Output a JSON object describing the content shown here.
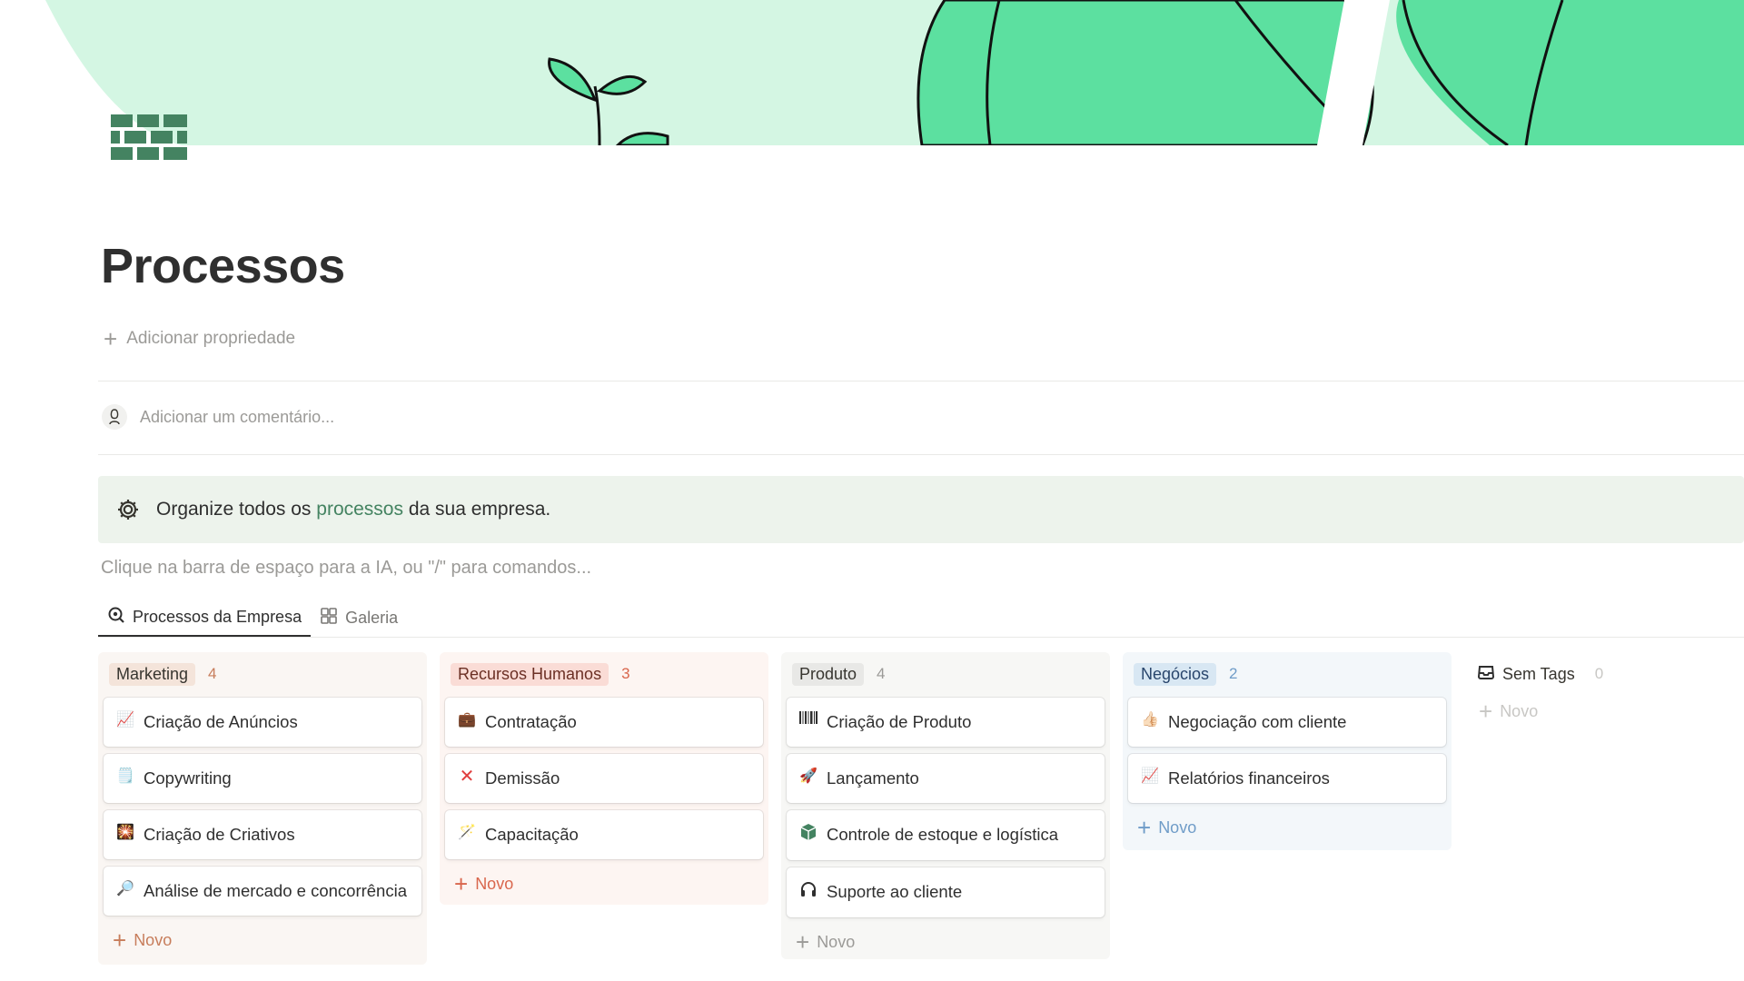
{
  "page": {
    "title": "Processos",
    "add_property": "Adicionar propriedade",
    "comment_placeholder": "Adicionar um comentário...",
    "callout": {
      "prefix": "Organize todos os",
      "highlight": "processos",
      "suffix": "da sua empresa."
    },
    "block_placeholder": "Clique na barra de espaço para a IA, ou \"/\" para comandos..."
  },
  "tabs": [
    {
      "label": "Processos da Empresa",
      "icon": "search-cog-icon",
      "active": true
    },
    {
      "label": "Galeria",
      "icon": "gallery-grid-icon",
      "active": false
    }
  ],
  "board": {
    "new_label": "Novo",
    "columns": [
      {
        "name": "Marketing",
        "count": "4",
        "cards": [
          {
            "icon": "chart-up-icon",
            "label": "Criação de Anúncios"
          },
          {
            "icon": "notepad-icon",
            "label": "Copywriting"
          },
          {
            "icon": "sparkle-image-icon",
            "label": "Criação de Criativos"
          },
          {
            "icon": "magnifier-icon",
            "label": "Análise de mercado e concorrência"
          }
        ]
      },
      {
        "name": "Recursos Humanos",
        "count": "3",
        "cards": [
          {
            "icon": "briefcase-icon",
            "label": "Contratação"
          },
          {
            "icon": "cross-mark-icon",
            "label": "Demissão"
          },
          {
            "icon": "magic-wand-icon",
            "label": "Capacitação"
          }
        ]
      },
      {
        "name": "Produto",
        "count": "4",
        "cards": [
          {
            "icon": "barcode-icon",
            "label": "Criação de Produto"
          },
          {
            "icon": "rocket-icon",
            "label": "Lançamento"
          },
          {
            "icon": "package-icon",
            "label": "Controle de estoque e logística"
          },
          {
            "icon": "headphones-icon",
            "label": "Suporte ao cliente"
          }
        ]
      },
      {
        "name": "Negócios",
        "count": "2",
        "cards": [
          {
            "icon": "thumbs-up-icon",
            "label": "Negociação com cliente"
          },
          {
            "icon": "chart-up-icon",
            "label": "Relatórios financeiros"
          }
        ]
      },
      {
        "name": "Sem Tags",
        "count": "0",
        "icon": "inbox-icon",
        "cards": []
      }
    ]
  },
  "colors": {
    "accent_green": "#448361",
    "cover_green": "#5ce0a0",
    "cover_light": "#d4f6e3",
    "icon_green": "#448361"
  }
}
